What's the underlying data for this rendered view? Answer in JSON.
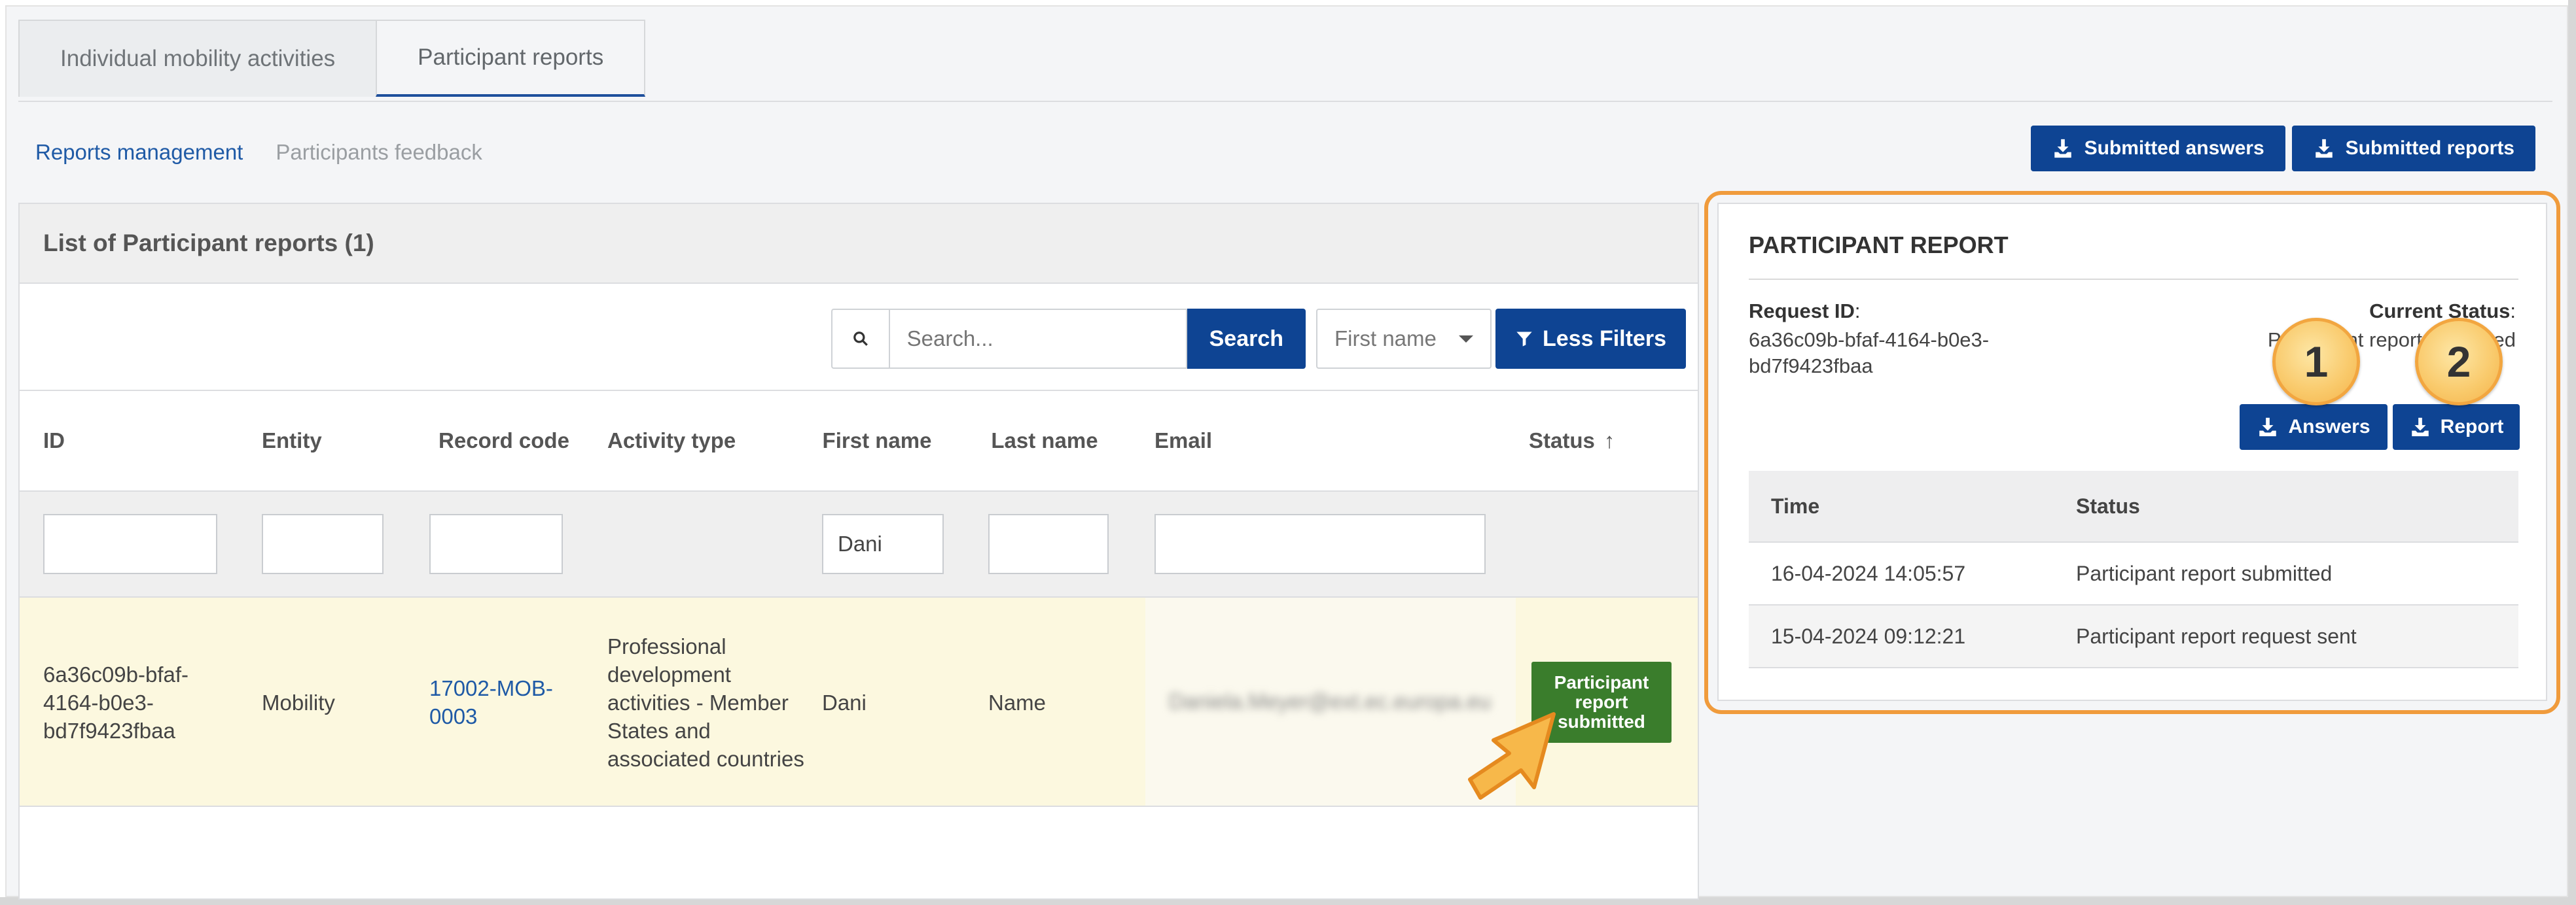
{
  "tabs": [
    {
      "label": "Individual mobility activities",
      "active": false
    },
    {
      "label": "Participant reports",
      "active": true
    }
  ],
  "subnav": {
    "reports_management": "Reports management",
    "participants_feedback": "Participants feedback"
  },
  "top_buttons": {
    "submitted_answers": "Submitted answers",
    "submitted_reports": "Submitted reports"
  },
  "list": {
    "title": "List of Participant reports (1)",
    "search_placeholder": "Search...",
    "search_button": "Search",
    "filter_field": "First name",
    "less_filters": "Less Filters",
    "columns": {
      "id": "ID",
      "entity": "Entity",
      "record_code": "Record code",
      "activity_type": "Activity type",
      "first_name": "First name",
      "last_name": "Last name",
      "email": "Email",
      "status": "Status",
      "status_sort": "↑"
    },
    "filters": {
      "first_name": "Dani"
    },
    "row": {
      "id": "6a36c09b-bfaf-4164-b0e3-bd7f9423fbaa",
      "entity": "Mobility",
      "record_code": "17002-MOB-0003",
      "activity_type": "Professional development activities - Member States and associated countries",
      "first_name": "Dani",
      "last_name": "Name",
      "email": "Daniela.Meyer@ext.ec.europa.eu",
      "status": "Participant report submitted"
    }
  },
  "report": {
    "title": "PARTICIPANT REPORT",
    "request_id_label": "Request ID",
    "request_id_value": "6a36c09b-bfaf-4164-b0e3-bd7f9423fbaa",
    "current_status_label": "Current Status",
    "current_status_value": "Participant report submitted",
    "answers_button": "Answers",
    "report_button": "Report",
    "history_headers": {
      "time": "Time",
      "status": "Status"
    },
    "history": [
      {
        "time": "16-04-2024 14:05:57",
        "status": "Participant report submitted"
      },
      {
        "time": "15-04-2024 09:12:21",
        "status": "Participant report request sent"
      }
    ]
  },
  "callouts": {
    "one": "1",
    "two": "2"
  },
  "colors": {
    "primary": "#0e4493",
    "highlight_row": "#fcf8df",
    "status_green": "#3a7d2c",
    "callout_outline": "#f09b3c"
  }
}
